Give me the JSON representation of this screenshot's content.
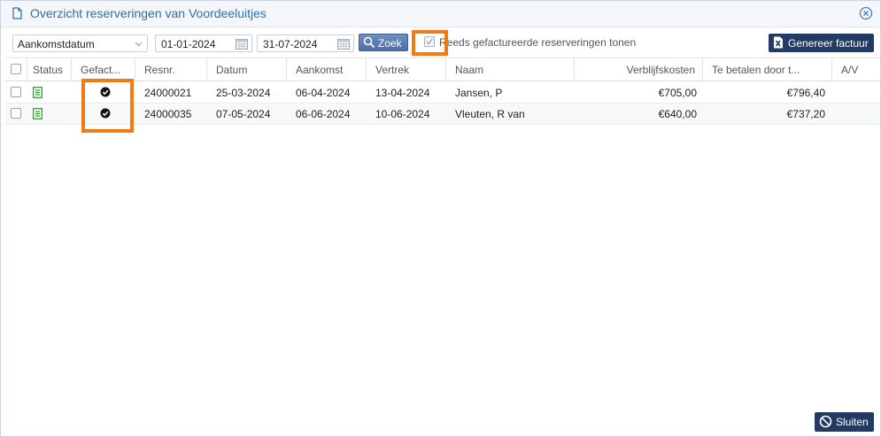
{
  "window": {
    "title": "Overzicht reserveringen van Voordeeluitjes",
    "title_icon": "document-icon",
    "close_icon": "close-circle-icon"
  },
  "toolbar": {
    "date_field": {
      "value": "Aankomstdatum",
      "icon": "chevron-down-icon"
    },
    "date_from": {
      "value": "01-01-2024",
      "icon": "calendar-icon"
    },
    "date_to": {
      "value": "31-07-2024",
      "icon": "calendar-icon"
    },
    "search_label": "Zoek",
    "search_icon": "search-icon",
    "show_invoiced_label": "Reeds gefactureerde reserveringen tonen",
    "show_invoiced_checked": true,
    "generate_invoice_label": "Genereer factuur",
    "generate_invoice_icon": "excel-icon"
  },
  "table": {
    "columns": {
      "status": "Status",
      "invoiced": "Gefact...",
      "resnr": "Resnr.",
      "datum": "Datum",
      "aankomst": "Aankomst",
      "vertrek": "Vertrek",
      "naam": "Naam",
      "verblijfskosten": "Verblijfskosten",
      "te_betalen": "Te betalen door t...",
      "av": "A/V"
    },
    "rows": [
      {
        "status_icon": "document-list-icon",
        "invoiced_icon": "check-circle-icon",
        "resnr": "24000021",
        "datum": "25-03-2024",
        "aankomst": "06-04-2024",
        "vertrek": "13-04-2024",
        "naam": "Jansen, P",
        "verblijfskosten": "€705,00",
        "te_betalen": "€796,40",
        "av": ""
      },
      {
        "status_icon": "document-list-icon",
        "invoiced_icon": "check-circle-icon",
        "resnr": "24000035",
        "datum": "07-05-2024",
        "aankomst": "06-06-2024",
        "vertrek": "10-06-2024",
        "naam": "Vleuten, R van",
        "verblijfskosten": "€640,00",
        "te_betalen": "€737,20",
        "av": ""
      }
    ]
  },
  "footer": {
    "close_label": "Sluiten",
    "close_icon": "ban-icon"
  },
  "colors": {
    "title": "#2b6fb0",
    "primary_button": "#233a63",
    "search_button": "#4b6fa8",
    "status_icon": "#3a9a3a",
    "highlight": "#f07a13"
  }
}
